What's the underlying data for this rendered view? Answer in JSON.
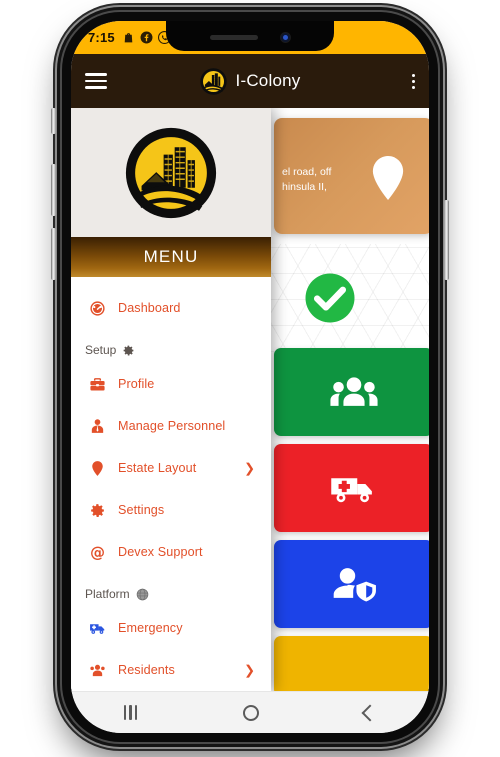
{
  "device": {
    "platform": "android",
    "statusbar": {
      "time": "7:15",
      "icons": [
        "shopping-bag-icon",
        "facebook-icon",
        "whatsapp-icon"
      ]
    },
    "navbar": {
      "recent_label": "Recent apps",
      "home_label": "Home",
      "back_label": "Back"
    }
  },
  "appbar": {
    "menu_icon": "hamburger-icon",
    "logo_icon": "app-logo-icon",
    "title": "I-Colony",
    "overflow_icon": "kebab-menu-icon"
  },
  "drawer": {
    "logo_icon": "app-logo-icon",
    "header_label": "MENU",
    "items": [
      {
        "label": "Dashboard",
        "icon": "dashboard-speedometer-icon",
        "type": "item",
        "chevron": false
      },
      {
        "label": "Setup",
        "icon": "gear-icon",
        "type": "section"
      },
      {
        "label": "Profile",
        "icon": "briefcase-icon",
        "type": "item",
        "chevron": false
      },
      {
        "label": "Manage Personnel",
        "icon": "user-tie-icon",
        "type": "item",
        "chevron": false
      },
      {
        "label": "Estate Layout",
        "icon": "map-marker-icon",
        "type": "item",
        "chevron": true
      },
      {
        "label": "Settings",
        "icon": "gear-icon",
        "type": "item",
        "chevron": false
      },
      {
        "label": "Devex Support",
        "icon": "at-sign-icon",
        "type": "item",
        "chevron": false
      },
      {
        "label": "Platform",
        "icon": "globe-emoji-icon",
        "type": "section"
      },
      {
        "label": "Emergency",
        "icon": "ambulance-icon",
        "type": "item",
        "chevron": false
      },
      {
        "label": "Residents",
        "icon": "people-group-icon",
        "type": "item",
        "chevron": true
      }
    ]
  },
  "page": {
    "address_card": {
      "line1": "el road, off",
      "line2": "hinsula II,",
      "icon": "location-pin-icon",
      "color": "#D79A5C"
    },
    "status_card": {
      "icon": "check-circle-icon",
      "color": "#22B844"
    },
    "tiles": [
      {
        "icon": "people-group-icon",
        "color": "#0E9440"
      },
      {
        "icon": "ambulance-icon",
        "color": "#EC2127"
      },
      {
        "icon": "user-shield-icon",
        "color": "#1C43E8"
      },
      {
        "icon": "tile-icon",
        "color": "#EFB400"
      }
    ]
  },
  "colors": {
    "brand_yellow": "#FFB500",
    "appbar_brown": "#2A1B0C",
    "accent_orange": "#E2502A",
    "menu_gradient_start": "#3A2003",
    "menu_gradient_end": "#C08A2C"
  }
}
